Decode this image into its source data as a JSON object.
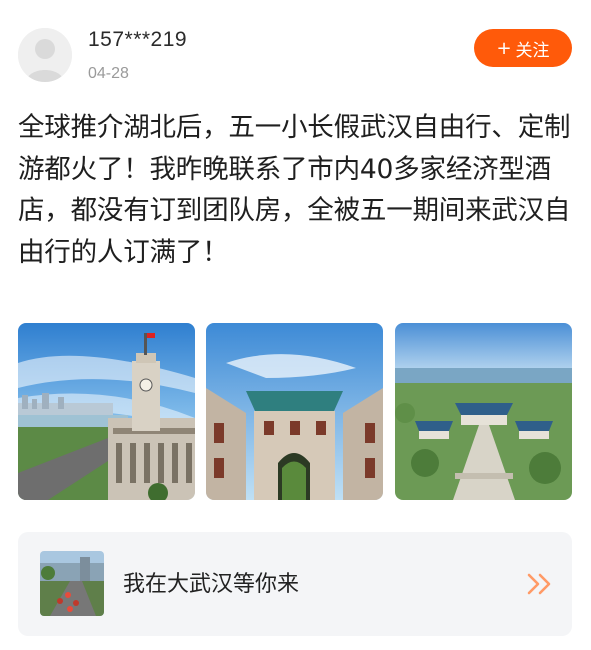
{
  "post": {
    "user_name": "157***219",
    "date": "04-28",
    "follow_label": "关注",
    "follow_plus": "+",
    "text": "全球推介湖北后，五一小长假武汉自由行、定制游都火了！我昨晚联系了市内40多家经济型酒店，都没有订到团队房，全被五一期间来武汉自由行的人订满了！"
  },
  "link_card": {
    "title": "我在大武汉等你来",
    "arrow_icon": "double-chevron-right-icon"
  },
  "colors": {
    "accent": "#ff5a0a",
    "card_bg": "#f4f5f7",
    "arrow": "#ff9a66"
  }
}
